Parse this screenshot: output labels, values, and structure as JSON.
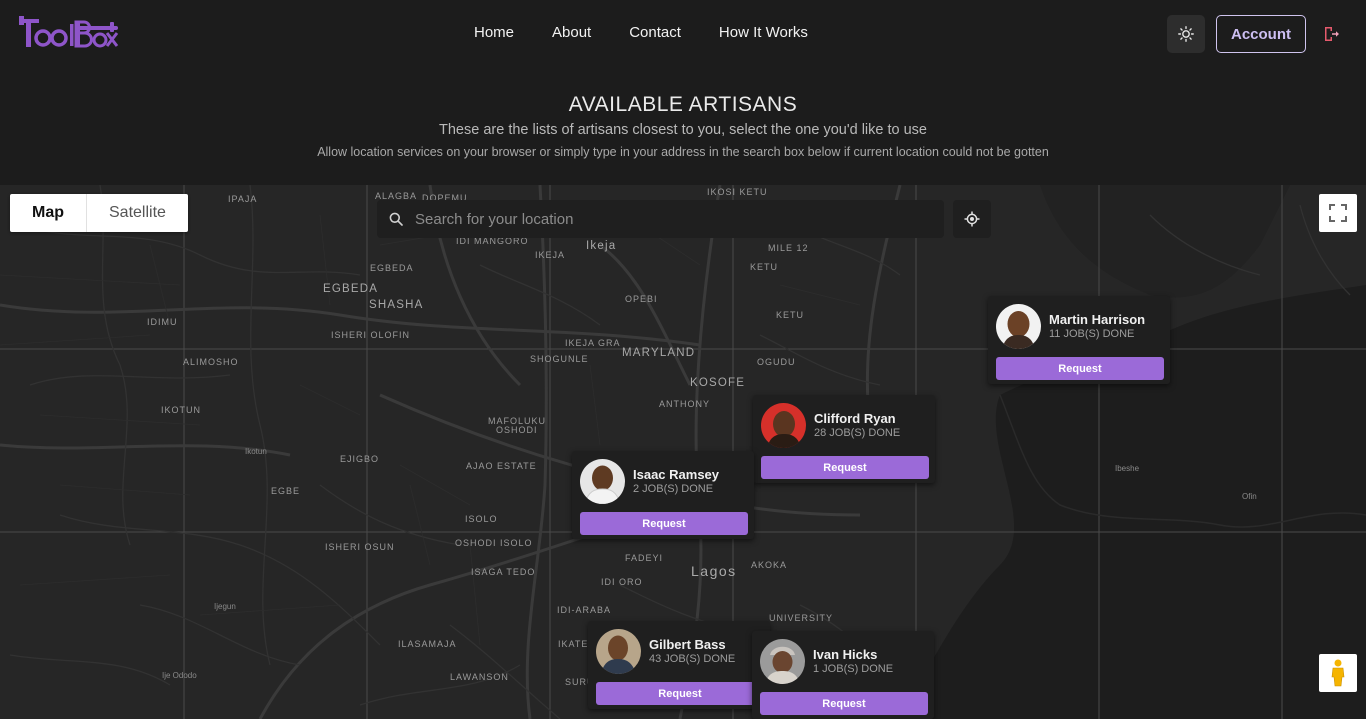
{
  "header": {
    "logo_text": "ToolBox",
    "nav": [
      "Home",
      "About",
      "Contact",
      "How It Works"
    ],
    "account_label": "Account",
    "theme_icon": "sun-icon",
    "logout_icon": "logout-icon",
    "brand_color": "#8e55c9"
  },
  "hero": {
    "title": "AVAILABLE ARTISANS",
    "subtitle": "These are the lists of artisans closest to you, select the one you'd like to use",
    "note": "Allow location services on your browser or simply type in your address in the search box below if current location could not be gotten"
  },
  "map": {
    "type_options": [
      "Map",
      "Satellite"
    ],
    "selected_type": "Map",
    "search_placeholder": "Search for your location",
    "labels": {
      "ipaja": "IPAJA",
      "alagba": "ALAGBA",
      "dopemu": "DOPEMU",
      "ikosi_ketu": "IKOSI KETU",
      "idi_mangoro": "IDI MANGORO",
      "ikeja": "Ikeja",
      "ikeja_caps": "IKEJA",
      "mile12": "MILE 12",
      "egbeda": "EGBEDA",
      "egbeda_big": "EGBEDA",
      "shasha": "SHASHA",
      "ketu": "KETU",
      "opebi": "OPEBI",
      "idimu": "IDIMU",
      "isheri_olofin": "ISHERI OLOFIN",
      "ikeja_gra": "IKEJA GRA",
      "ketu2": "KETU",
      "shogunle": "SHOGUNLE",
      "maryland": "MARYLAND",
      "ogudu": "OGUDU",
      "alimosho": "ALIMOSHO",
      "kosofe": "KOSOFE",
      "anthony": "ANTHONY",
      "ikotun": "IKOTUN",
      "mafoluku": "MAFOLUKU",
      "oshodi": "OSHODI",
      "ikotun_small": "Ikotun",
      "ejigbo": "EJIGBO",
      "ajao_estate": "AJAO ESTATE",
      "egbe": "EGBE",
      "isolo": "ISOLO",
      "isheri_osun": "ISHERI OSUN",
      "oshodi_isolo": "OSHODI ISOLO",
      "fadeyi": "FADEYI",
      "isaga_tedo": "ISAGA TEDO",
      "lagos": "Lagos",
      "akoka": "AKOKA",
      "idi_oro": "IDI ORO",
      "ijegun": "Ijegun",
      "idi_araba": "IDI-ARABA",
      "university": "UNIVERSITY",
      "ilasamaja": "ILASAMAJA",
      "ikate": "IKATE",
      "lawanson": "LAWANSON",
      "ije_ododo": "Ije Ododo",
      "suru": "SURU",
      "ibeshe": "Ibeshe",
      "ofin": "Ofin"
    }
  },
  "artisans": [
    {
      "name": "Martin Harrison",
      "jobs": "11 JOB(S) DONE",
      "request": "Request"
    },
    {
      "name": "Clifford Ryan",
      "jobs": "28 JOB(S) DONE",
      "request": "Request"
    },
    {
      "name": "Isaac Ramsey",
      "jobs": "2 JOB(S) DONE",
      "request": "Request"
    },
    {
      "name": "Gilbert Bass",
      "jobs": "43 JOB(S) DONE",
      "request": "Request"
    },
    {
      "name": "Ivan Hicks",
      "jobs": "1 JOB(S) DONE",
      "request": "Request"
    }
  ]
}
